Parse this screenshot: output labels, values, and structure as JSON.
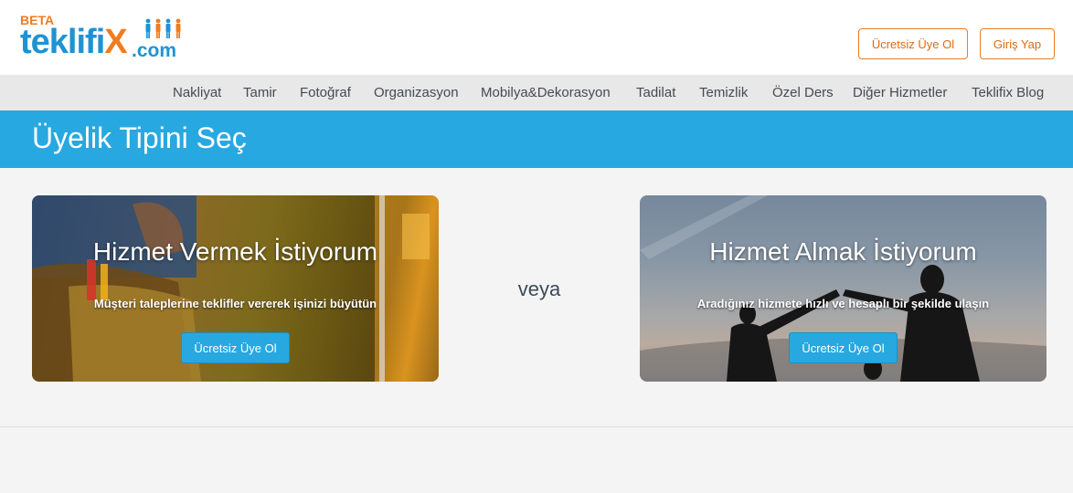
{
  "header": {
    "logo": {
      "beta": "BETA",
      "brand_main": "teklifi",
      "brand_x": "X",
      "brand_domain": ".com"
    },
    "register_label": "Ücretsiz Üye Ol",
    "login_label": "Giriş Yap"
  },
  "nav": {
    "items": [
      {
        "label": "Nakliyat"
      },
      {
        "label": "Tamir"
      },
      {
        "label": "Fotoğraf"
      },
      {
        "label": "Organizasyon"
      },
      {
        "label": "Mobilya&Dekorasyon"
      },
      {
        "label": "Tadilat"
      },
      {
        "label": "Temizlik"
      },
      {
        "label": "Özel Ders"
      },
      {
        "label": "Diğer Hizmetler"
      },
      {
        "label": "Teklifix Blog"
      }
    ]
  },
  "page": {
    "title": "Üyelik Tipini Seç",
    "or_text": "veya"
  },
  "cards": [
    {
      "title": "Hizmet Vermek İstiyorum",
      "subtitle": "Müşteri taleplerine teklifler vererek işinizi büyütün",
      "button": "Ücretsiz Üye Ol"
    },
    {
      "title": "Hizmet Almak İstiyorum",
      "subtitle": "Aradığınız hizmete hızlı ve hesaplı bir şekilde ulaşın",
      "button": "Ücretsiz Üye Ol"
    }
  ],
  "colors": {
    "brand_blue": "#1e93d3",
    "brand_orange": "#f07c1e",
    "title_bar": "#27a8e0"
  }
}
